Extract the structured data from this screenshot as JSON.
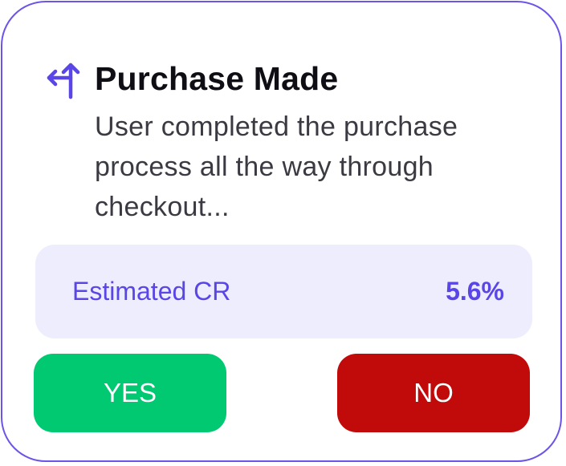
{
  "card": {
    "title": "Purchase Made",
    "description": "User completed the purchase process all the way through checkout...",
    "icon": "turn-up-left-arrow-icon"
  },
  "metric": {
    "label": "Estimated CR",
    "value": "5.6%"
  },
  "actions": {
    "yes_label": "YES",
    "no_label": "NO"
  },
  "colors": {
    "border": "#6b55e8",
    "accent": "#5a46e6",
    "metric_bg": "#ededfd",
    "yes": "#00c972",
    "no": "#c10a0a"
  }
}
